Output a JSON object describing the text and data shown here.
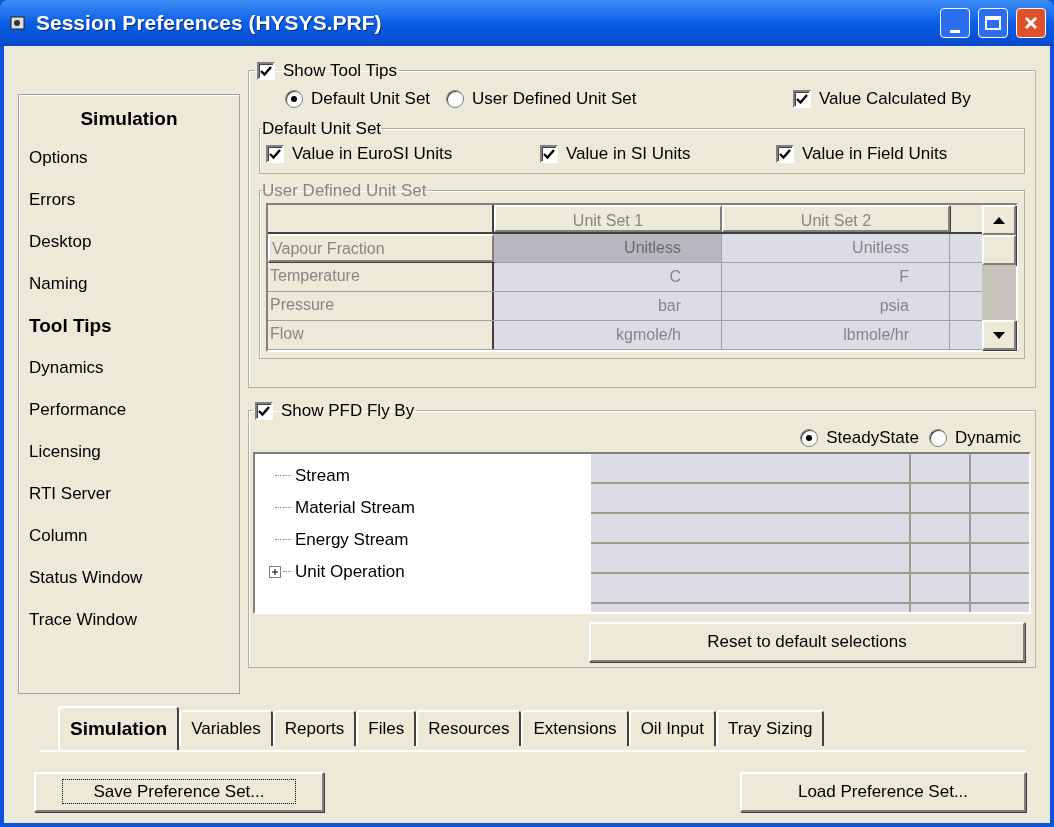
{
  "window": {
    "title": "Session Preferences (HYSYS.PRF)"
  },
  "sidebar": {
    "header": "Simulation",
    "items": [
      {
        "label": "Options",
        "selected": false
      },
      {
        "label": "Errors",
        "selected": false
      },
      {
        "label": "Desktop",
        "selected": false
      },
      {
        "label": "Naming",
        "selected": false
      },
      {
        "label": "Tool Tips",
        "selected": true
      },
      {
        "label": "Dynamics",
        "selected": false
      },
      {
        "label": "Performance",
        "selected": false
      },
      {
        "label": "Licensing",
        "selected": false
      },
      {
        "label": "RTI Server",
        "selected": false
      },
      {
        "label": "Column",
        "selected": false
      },
      {
        "label": "Status Window",
        "selected": false
      },
      {
        "label": "Trace Window",
        "selected": false
      }
    ]
  },
  "tool_tips": {
    "label": "Show Tool Tips",
    "checked": true,
    "unit_options": [
      {
        "label": "Default Unit Set",
        "selected": true
      },
      {
        "label": "User Defined Unit Set",
        "selected": false
      }
    ],
    "value_calculated_by": {
      "label": "Value Calculated By",
      "checked": true
    },
    "default_unit_set": {
      "title": "Default Unit Set",
      "options": [
        {
          "label": "Value in EuroSI Units",
          "checked": true
        },
        {
          "label": "Value in SI Units",
          "checked": true
        },
        {
          "label": "Value in Field Units",
          "checked": true
        }
      ]
    },
    "user_defined_unit_set": {
      "title": "User Defined Unit Set",
      "disabled": true,
      "columns": [
        "Unit Set 1",
        "Unit Set 2"
      ],
      "rows": [
        {
          "label": "Vapour Fraction",
          "cells": [
            {
              "text": "Unitless",
              "selected": true
            },
            {
              "text": "Unitless",
              "selected": false
            }
          ]
        },
        {
          "label": "Temperature",
          "cells": [
            {
              "text": "C",
              "selected": false
            },
            {
              "text": "F",
              "selected": false
            }
          ]
        },
        {
          "label": "Pressure",
          "cells": [
            {
              "text": "bar",
              "selected": false
            },
            {
              "text": "psia",
              "selected": false
            }
          ]
        },
        {
          "label": "Flow",
          "cells": [
            {
              "text": "kgmole/h",
              "selected": false
            },
            {
              "text": "lbmole/hr",
              "selected": false
            }
          ]
        }
      ]
    }
  },
  "pfd_fly_by": {
    "label": "Show PFD Fly By",
    "checked": true,
    "modes": [
      {
        "label": "SteadyState",
        "selected": true
      },
      {
        "label": "Dynamic",
        "selected": false
      }
    ],
    "tree": [
      {
        "label": "Stream",
        "kind": "leaf"
      },
      {
        "label": "Material Stream",
        "kind": "leaf"
      },
      {
        "label": "Energy Stream",
        "kind": "leaf"
      },
      {
        "label": "Unit Operation",
        "kind": "group",
        "expanded": false
      }
    ],
    "reset_button": "Reset to default selections"
  },
  "tabs": [
    {
      "label": "Simulation",
      "selected": true
    },
    {
      "label": "Variables",
      "selected": false
    },
    {
      "label": "Reports",
      "selected": false
    },
    {
      "label": "Files",
      "selected": false
    },
    {
      "label": "Resources",
      "selected": false
    },
    {
      "label": "Extensions",
      "selected": false
    },
    {
      "label": "Oil Input",
      "selected": false
    },
    {
      "label": "Tray Sizing",
      "selected": false
    }
  ],
  "buttons": {
    "save": {
      "label": "Save Preference Set...",
      "focused": true
    },
    "load": {
      "label": "Load Preference Set..."
    }
  }
}
